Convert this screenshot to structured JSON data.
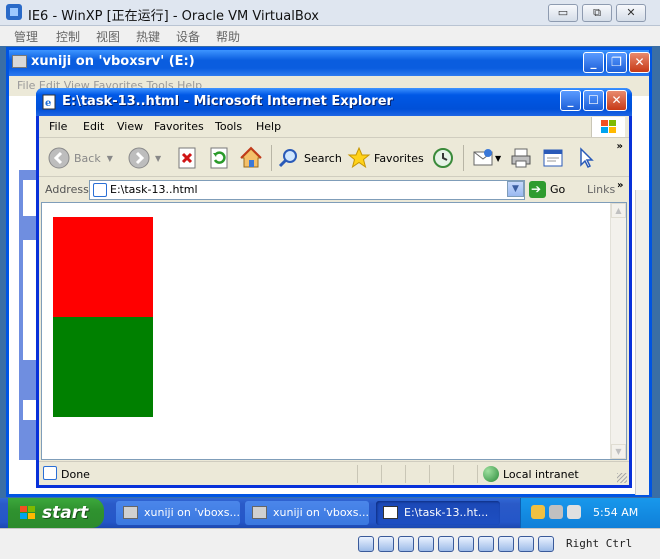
{
  "vbox": {
    "title": "IE6 - WinXP [正在运行] - Oracle VM VirtualBox",
    "menu": [
      "管理",
      "控制",
      "视图",
      "热键",
      "设备",
      "帮助"
    ],
    "host_key": "Right Ctrl",
    "controls": {
      "minimize": "▭",
      "restore": "⧉",
      "close": "✕"
    }
  },
  "background_window": {
    "title": "xuniji on 'vboxsrv' (E:)",
    "menu": "File   Edit   View   Favorites   Tools   Help"
  },
  "ie": {
    "title": "E:\\task-13..html - Microsoft Internet Explorer",
    "menu": [
      "File",
      "Edit",
      "View",
      "Favorites",
      "Tools",
      "Help"
    ],
    "toolbar": {
      "back": "Back",
      "search": "Search",
      "favorites": "Favorites"
    },
    "address": {
      "label": "Address",
      "value": "E:\\task-13..html",
      "go": "Go",
      "links": "Links"
    },
    "content": {
      "red_box_color": "#ff0000",
      "green_box_color": "#008000"
    },
    "status": {
      "text": "Done",
      "zone": "Local intranet"
    }
  },
  "taskbar": {
    "start": "start",
    "tasks": [
      {
        "label": "xuniji on 'vboxs...",
        "active": false
      },
      {
        "label": "xuniji on 'vboxs...",
        "active": false
      },
      {
        "label": "E:\\task-13..ht...",
        "active": true
      }
    ],
    "clock": "5:54 AM"
  },
  "colors": {
    "xp_title_blue": "#0054e3",
    "taskbar_blue": "#2456c8",
    "start_green": "#2f922f"
  }
}
